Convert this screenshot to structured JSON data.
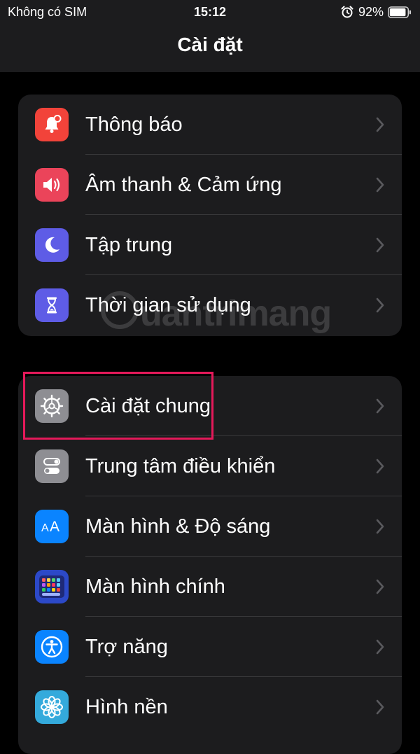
{
  "status_bar": {
    "carrier": "Không có SIM",
    "time": "15:12",
    "battery": "92%",
    "battery_level": 0.92,
    "alarm_icon": "alarm-clock-icon"
  },
  "header": {
    "title": "Cài đặt"
  },
  "watermark": {
    "text": "uantrimang"
  },
  "groups": [
    {
      "items": [
        {
          "label": "Thông báo",
          "icon": "bell-icon",
          "color": "#f2433a"
        },
        {
          "label": "Âm thanh & Cảm ứng",
          "icon": "speaker-icon",
          "color": "#eb445a"
        },
        {
          "label": "Tập trung",
          "icon": "moon-icon",
          "color": "#5e5ce6"
        },
        {
          "label": "Thời gian sử dụng",
          "icon": "hourglass-icon",
          "color": "#5e5ce6"
        }
      ]
    },
    {
      "items": [
        {
          "label": "Cài đặt chung",
          "icon": "gear-icon",
          "color": "#8e8e93",
          "highlighted": true
        },
        {
          "label": "Trung tâm điều khiển",
          "icon": "toggles-icon",
          "color": "#8e8e93"
        },
        {
          "label": "Màn hình & Độ sáng",
          "icon": "text-size-icon",
          "color": "#0a84ff"
        },
        {
          "label": "Màn hình chính",
          "icon": "app-grid-icon",
          "color": "#2c49c8"
        },
        {
          "label": "Trợ năng",
          "icon": "accessibility-icon",
          "color": "#0a84ff"
        },
        {
          "label": "Hình nền",
          "icon": "flower-icon",
          "color": "#34aadc"
        }
      ]
    }
  ],
  "colors": {
    "background": "#000000",
    "cell": "#1c1c1e",
    "separator": "#38383a",
    "chevron": "#5a5a5e",
    "highlight": "#e5195a"
  }
}
